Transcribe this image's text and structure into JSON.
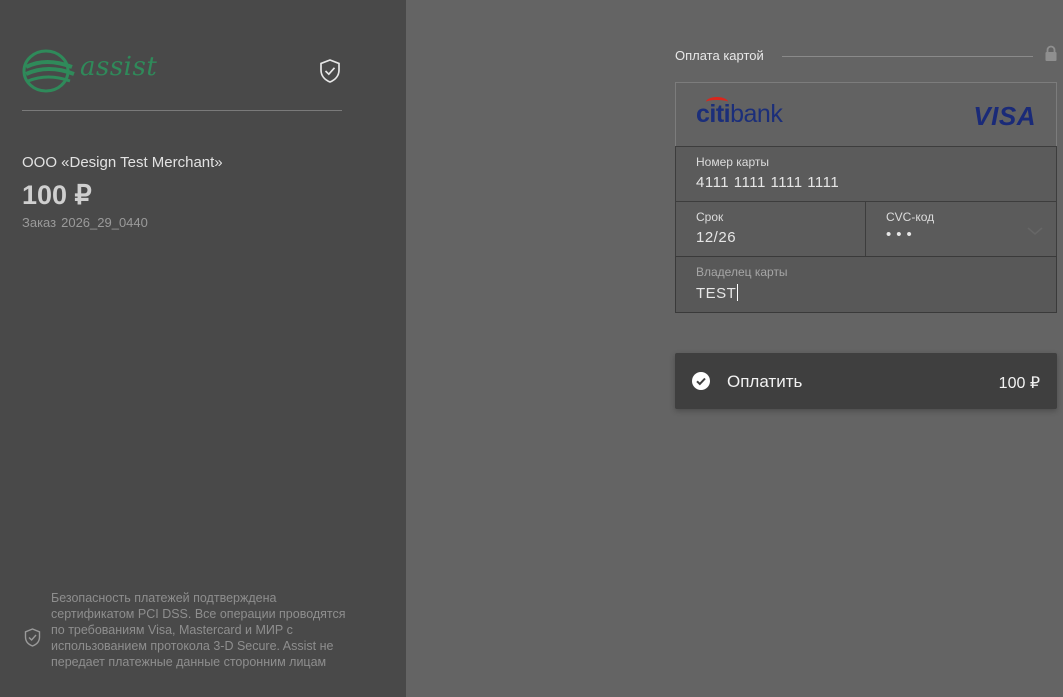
{
  "brand": {
    "logo_text": "assist"
  },
  "order_summary": {
    "merchant": "ООО «Design Test Merchant»",
    "amount": "100 ₽",
    "order_label": "Заказ",
    "order_number": "2026_29_0440"
  },
  "security_note": "Безопасность платежей подтверждена сертификатом PCI DSS. Все операции проводятся по требованиям Visa, Mastercard и МИР с использованием протокола 3-D Secure. Assist не передает платежные данные сторонним лицам",
  "payment_form": {
    "title": "Оплата картой",
    "bank_name_part1": "citi",
    "bank_name_part2": "bank",
    "card_brand": "VISA",
    "card_number": {
      "label": "Номер карты",
      "value": "4111 1111 1111 1111"
    },
    "expiry": {
      "label": "Срок",
      "value": "12/26"
    },
    "cvc": {
      "label": "CVC-код",
      "value": "•••"
    },
    "holder": {
      "label": "Владелец карты",
      "value": "TEST"
    },
    "pay_button": {
      "label": "Оплатить",
      "amount": "100 ₽"
    }
  },
  "icons": {
    "logo": "assist-logo-icon",
    "shield": "shield-check-icon",
    "lock": "lock-icon",
    "pay": "check-circle-icon",
    "cvc_hint": "chevron-down-icon"
  },
  "colors": {
    "left_panel": "#494949",
    "right_panel": "#646464",
    "logo_green": "#2f8a5a",
    "button_bg": "#3f3f3f",
    "visa_blue": "#1a2a78",
    "citi_red": "#d9261c"
  }
}
